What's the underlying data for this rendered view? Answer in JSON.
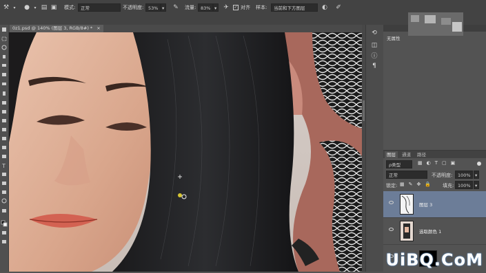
{
  "options_bar": {
    "mode_label": "模式:",
    "mode_value": "正常",
    "opacity_label": "不透明度:",
    "opacity_value": "53%",
    "flow_label": "流量:",
    "flow_value": "83%",
    "align_label": "对齐",
    "sample_label": "样本:",
    "sample_value": "当前和下方图层"
  },
  "document_tab": {
    "title": "0z1.psd @ 140% (图层 3, RGB/8#) *",
    "close": "×"
  },
  "properties_panel": {
    "title": "无属性"
  },
  "layers_panel": {
    "tabs": [
      "图层",
      "通道",
      "路径"
    ],
    "filter_value": "ρ类型",
    "blend_mode": "正常",
    "opacity_label": "不透明度:",
    "opacity_value": "100%",
    "lock_label": "锁定:",
    "fill_label": "填充:",
    "fill_value": "100%",
    "layers": [
      {
        "name": "图层 3",
        "selected": true
      },
      {
        "name": "选取颜色 1",
        "selected": false
      }
    ]
  },
  "watermark": "UiBQ.CoM",
  "colors": {
    "selection": "#6c7d98",
    "panel": "#535353",
    "bar": "#434343"
  }
}
